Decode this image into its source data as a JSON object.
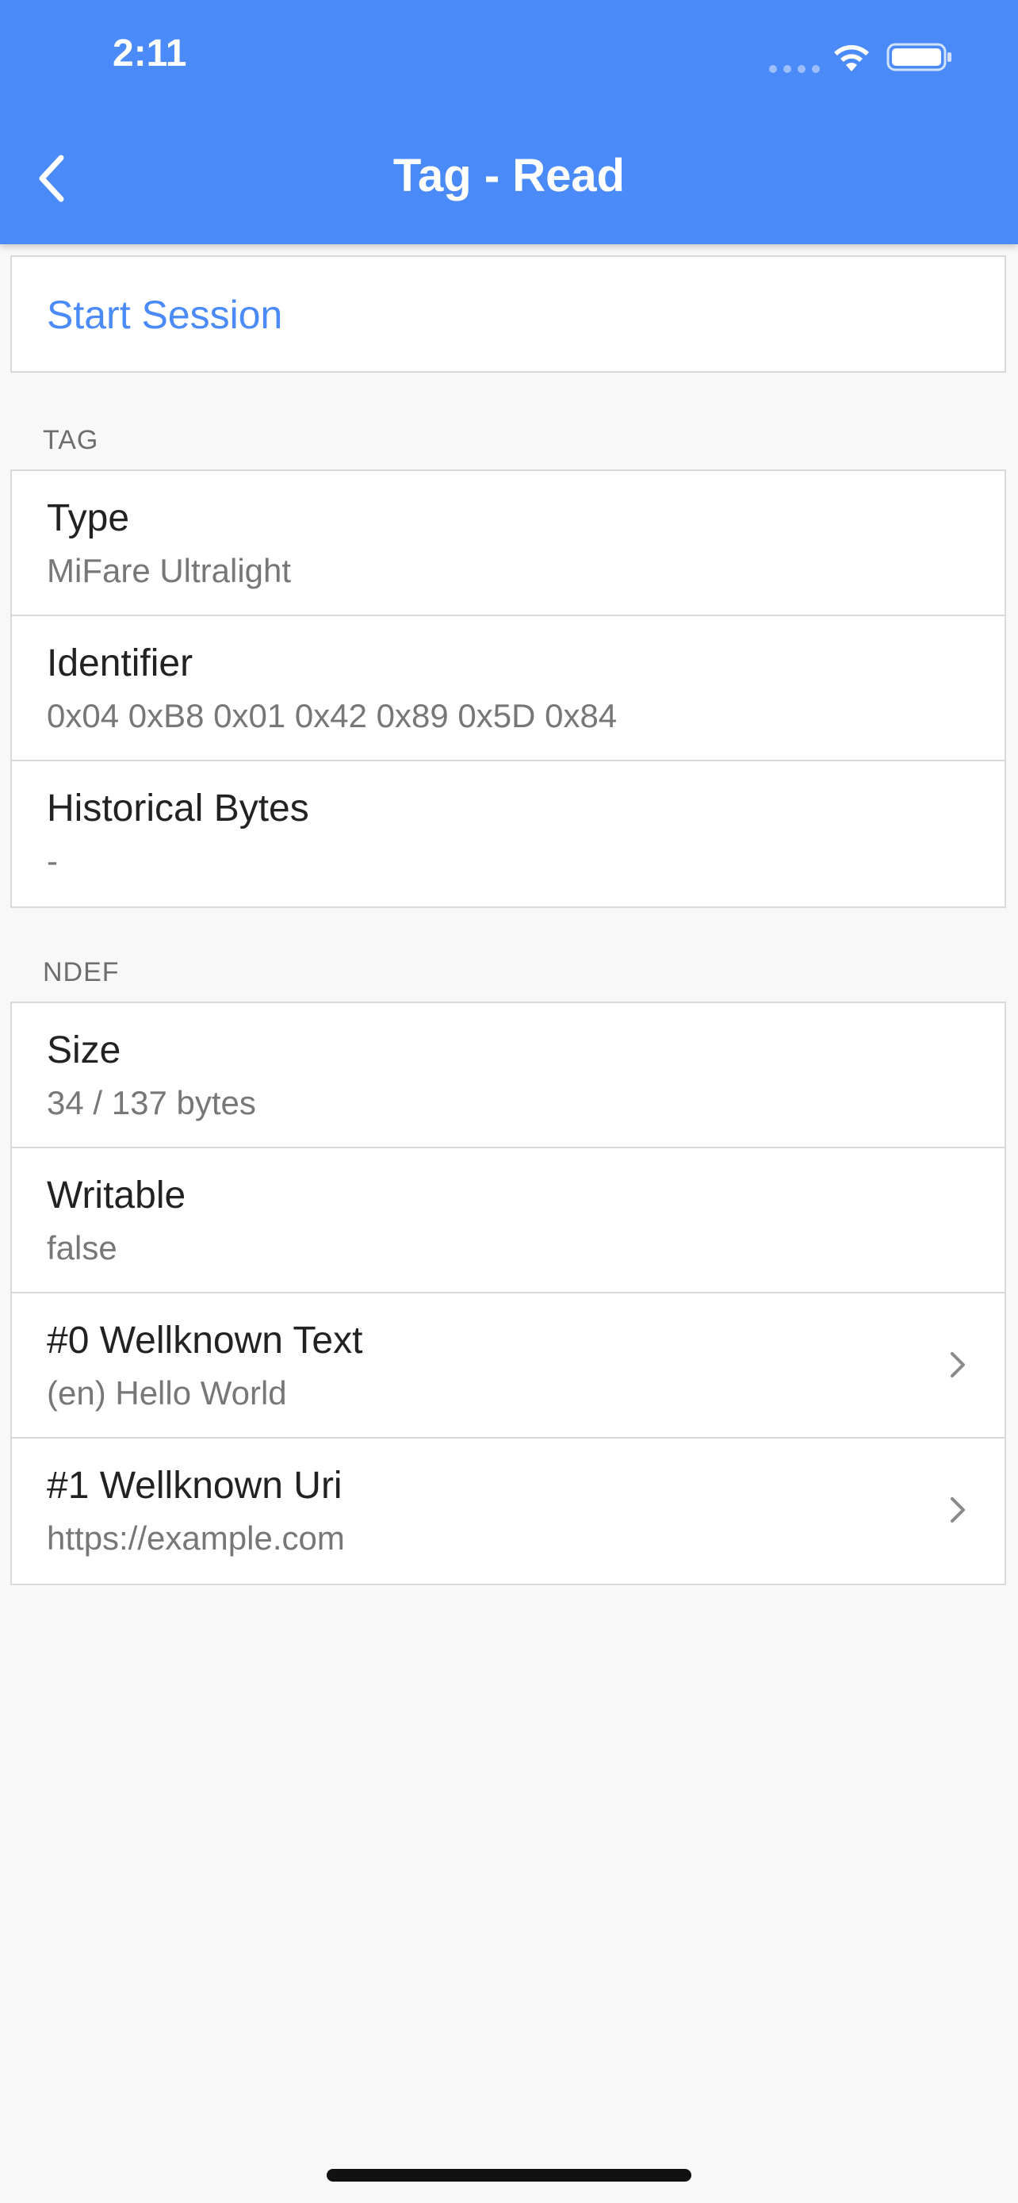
{
  "status_bar": {
    "time": "2:11"
  },
  "app_bar": {
    "title": "Tag - Read",
    "back_icon": "chevron-left-icon"
  },
  "session": {
    "start_label": "Start Session"
  },
  "tag_section": {
    "header": "TAG",
    "rows": [
      {
        "title": "Type",
        "value": "MiFare Ultralight"
      },
      {
        "title": "Identifier",
        "value": "0x04 0xB8 0x01 0x42 0x89 0x5D 0x84"
      },
      {
        "title": "Historical Bytes",
        "value": "-"
      }
    ]
  },
  "ndef_section": {
    "header": "NDEF",
    "rows": [
      {
        "title": "Size",
        "value": "34 / 137 bytes"
      },
      {
        "title": "Writable",
        "value": "false"
      },
      {
        "title": "#0 Wellknown Text",
        "value": "(en) Hello World"
      },
      {
        "title": "#1 Wellknown Uri",
        "value": "https://example.com"
      }
    ]
  },
  "colors": {
    "accent": "#4b8af9",
    "background": "#f8f8f8",
    "divider": "#d9d9d9"
  }
}
